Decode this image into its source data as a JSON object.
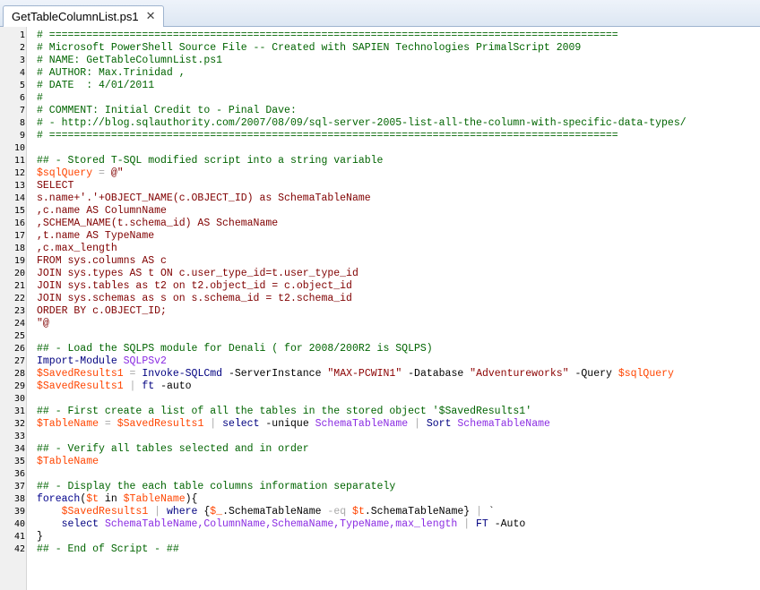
{
  "tab": {
    "title": "GetTableColumnList.ps1",
    "close_glyph": "✕"
  },
  "colors": {
    "comment": "#006400",
    "here_string": "#800000",
    "variable": "#ff4500",
    "keyword": "#00008b",
    "command": "#000080",
    "parameter": "#4b4bff",
    "member": "#8a2be2",
    "operator": "#a9a9a9",
    "string": "#8b0000"
  },
  "lines": [
    [
      [
        "c",
        "# ============================================================================================"
      ]
    ],
    [
      [
        "c",
        "# Microsoft PowerShell Source File -- Created with SAPIEN Technologies PrimalScript 2009"
      ]
    ],
    [
      [
        "c",
        "# NAME: GetTableColumnList.ps1"
      ]
    ],
    [
      [
        "c",
        "# AUTHOR: Max.Trinidad ,"
      ]
    ],
    [
      [
        "c",
        "# DATE  : 4/01/2011"
      ]
    ],
    [
      [
        "c",
        "#"
      ]
    ],
    [
      [
        "c",
        "# COMMENT: Initial Credit to - Pinal Dave:"
      ]
    ],
    [
      [
        "c",
        "# - http://blog.sqlauthority.com/2007/08/09/sql-server-2005-list-all-the-column-with-specific-data-types/"
      ]
    ],
    [
      [
        "c",
        "# ============================================================================================"
      ]
    ],
    [],
    [
      [
        "c",
        "## - Stored T-SQL modified script into a string variable"
      ]
    ],
    [
      [
        "v",
        "$sqlQuery"
      ],
      [
        "o",
        " = "
      ],
      [
        "d",
        "@\""
      ]
    ],
    [
      [
        "d",
        "SELECT"
      ]
    ],
    [
      [
        "d",
        "s.name+'.'+OBJECT_NAME(c.OBJECT_ID) as SchemaTableName"
      ]
    ],
    [
      [
        "d",
        ",c.name AS ColumnName"
      ]
    ],
    [
      [
        "d",
        ",SCHEMA_NAME(t.schema_id) AS SchemaName"
      ]
    ],
    [
      [
        "d",
        ",t.name AS TypeName"
      ]
    ],
    [
      [
        "d",
        ",c.max_length"
      ]
    ],
    [
      [
        "d",
        "FROM sys.columns AS c"
      ]
    ],
    [
      [
        "d",
        "JOIN sys.types AS t ON c.user_type_id=t.user_type_id"
      ]
    ],
    [
      [
        "d",
        "JOIN sys.tables as t2 on t2.object_id = c.object_id"
      ]
    ],
    [
      [
        "d",
        "JOIN sys.schemas as s on s.schema_id = t2.schema_id"
      ]
    ],
    [
      [
        "d",
        "ORDER BY c.OBJECT_ID;"
      ]
    ],
    [
      [
        "d",
        "\"@"
      ]
    ],
    [],
    [
      [
        "c",
        "## - Load the SQLPS module for Denali ( for 2008/200R2 is SQLPS)"
      ]
    ],
    [
      [
        "m",
        "Import-Module"
      ],
      [
        "t",
        " "
      ],
      [
        "s",
        "SQLPSv2"
      ]
    ],
    [
      [
        "v",
        "$SavedResults1"
      ],
      [
        "o",
        " = "
      ],
      [
        "m",
        "Invoke-SQLCmd"
      ],
      [
        "t",
        " "
      ],
      [
        "t",
        "-ServerInstance"
      ],
      [
        "t",
        " "
      ],
      [
        "str",
        "\"MAX-PCWIN1\""
      ],
      [
        "t",
        " "
      ],
      [
        "t",
        "-Database"
      ],
      [
        "t",
        " "
      ],
      [
        "str",
        "\"Adventureworks\""
      ],
      [
        "t",
        " "
      ],
      [
        "t",
        "-Query"
      ],
      [
        "t",
        " "
      ],
      [
        "v",
        "$sqlQuery"
      ]
    ],
    [
      [
        "v",
        "$SavedResults1"
      ],
      [
        "o",
        " | "
      ],
      [
        "m",
        "ft"
      ],
      [
        "t",
        " "
      ],
      [
        "t",
        "-auto"
      ]
    ],
    [],
    [
      [
        "c",
        "## - First create a list of all the tables in the stored object '$SavedResults1'"
      ]
    ],
    [
      [
        "v",
        "$TableName"
      ],
      [
        "o",
        " = "
      ],
      [
        "v",
        "$SavedResults1"
      ],
      [
        "o",
        " | "
      ],
      [
        "m",
        "select"
      ],
      [
        "t",
        " "
      ],
      [
        "t",
        "-unique"
      ],
      [
        "t",
        " "
      ],
      [
        "s",
        "SchemaTableName"
      ],
      [
        "o",
        " | "
      ],
      [
        "m",
        "Sort"
      ],
      [
        "t",
        " "
      ],
      [
        "s",
        "SchemaTableName"
      ]
    ],
    [],
    [
      [
        "c",
        "## - Verify all tables selected and in order"
      ]
    ],
    [
      [
        "v",
        "$TableName"
      ]
    ],
    [],
    [
      [
        "c",
        "## - Display the each table columns information separately"
      ]
    ],
    [
      [
        "k",
        "foreach"
      ],
      [
        "t",
        "("
      ],
      [
        "v",
        "$t"
      ],
      [
        "t",
        " in "
      ],
      [
        "v",
        "$TableName"
      ],
      [
        "t",
        "){"
      ]
    ],
    [
      [
        "t",
        "    "
      ],
      [
        "v",
        "$SavedResults1"
      ],
      [
        "o",
        " | "
      ],
      [
        "m",
        "where"
      ],
      [
        "t",
        " {"
      ],
      [
        "v",
        "$_"
      ],
      [
        "t",
        ".SchemaTableName "
      ],
      [
        "o",
        "-eq"
      ],
      [
        "t",
        " "
      ],
      [
        "v",
        "$t"
      ],
      [
        "t",
        ".SchemaTableName}"
      ],
      [
        "o",
        " | "
      ],
      [
        "t",
        "`"
      ]
    ],
    [
      [
        "t",
        "    "
      ],
      [
        "m",
        "select"
      ],
      [
        "t",
        " "
      ],
      [
        "s",
        "SchemaTableName,ColumnName,SchemaName,TypeName,max_length"
      ],
      [
        "o",
        " | "
      ],
      [
        "m",
        "FT"
      ],
      [
        "t",
        " "
      ],
      [
        "t",
        "-Auto"
      ]
    ],
    [
      [
        "t",
        "}"
      ]
    ],
    [
      [
        "c",
        "## - End of Script - ##"
      ]
    ]
  ]
}
